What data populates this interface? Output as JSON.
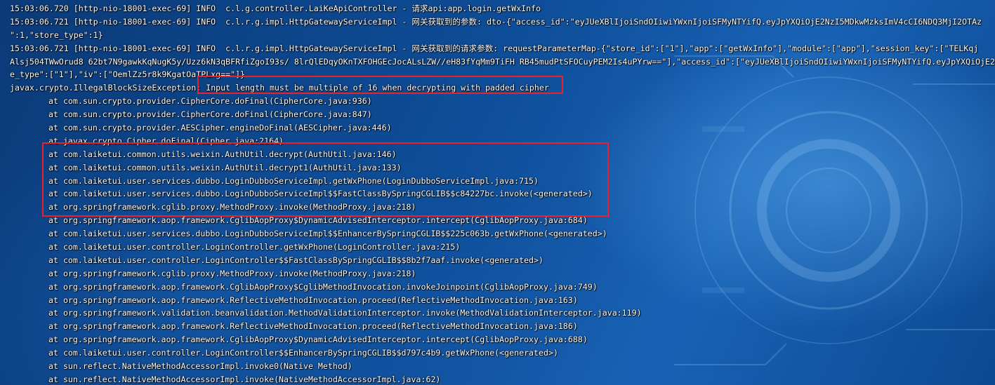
{
  "log": {
    "head_lines": [
      "15:03:06.720 [http-nio-18001-exec-69] INFO  c.l.g.controller.LaiKeApiController - 请求api:app.login.getWxInfo",
      "15:03:06.721 [http-nio-18001-exec-69] INFO  c.l.r.g.impl.HttpGatewayServiceImpl - 网关获取到的参数: dto-{\"access_id\":\"eyJUeXBlIjoiSndOIiwiYWxnIjoiSFMyNTYifQ.eyJpYXQiOjE2NzI5MDkwMzksImV4cCI6NDQ3MjI2OTAz",
      "\":1,\"store_type\":1}",
      "15:03:06.721 [http-nio-18001-exec-69] INFO  c.l.r.g.impl.HttpGatewayServiceImpl - 网关获取到的请求参数: requestParameterMap-{\"store_id\":[\"1\"],\"app\":[\"getWxInfo\"],\"module\":[\"app\"],\"session_key\":[\"TELKqj",
      "Alsj504TWwOrud8 62bt7N9gawkKqNugK5y/Uzz6kN3qBFRfiZgoI93s/ 8lrQlEDqyOKnTXFOHGEcJocALsLZW//eH83fYqMm9TiFH RB45mudPtSFOCuyPEM2Is4uPYrw==\"],\"access_id\":[\"eyJUeXBlIjoiSndOIiwiYWxnIjoiSFMyNTYifQ.eyJpYXQiOjE2",
      "e_type\":[\"1\"],\"iv\":[\"OemlZz5r8k9KgatOaTPLxg==\"]}"
    ],
    "exception_class": "javax.crypto.IllegalBlockSizeException:",
    "exception_message": " Input length must be multiple of 16 when decrypting with padded cipher",
    "stack_frames": [
      "at com.sun.crypto.provider.CipherCore.doFinal(CipherCore.java:936)",
      "at com.sun.crypto.provider.CipherCore.doFinal(CipherCore.java:847)",
      "at com.sun.crypto.provider.AESCipher.engineDoFinal(AESCipher.java:446)",
      "at javax.crypto.Cipher.doFinal(Cipher.java:2164)",
      "at com.laiketui.common.utils.weixin.AuthUtil.decrypt(AuthUtil.java:146)",
      "at com.laiketui.common.utils.weixin.AuthUtil.decrypt1(AuthUtil.java:133)",
      "at com.laiketui.user.services.dubbo.LoginDubboServiceImpl.getWxPhone(LoginDubboServiceImpl.java:715)",
      "at com.laiketui.user.services.dubbo.LoginDubboServiceImpl$$FastClassBySpringCGLIB$$c84227bc.invoke(<generated>)",
      "at org.springframework.cglib.proxy.MethodProxy.invoke(MethodProxy.java:218)",
      "at org.springframework.aop.framework.CglibAopProxy$DynamicAdvisedInterceptor.intercept(CglibAopProxy.java:684)",
      "at com.laiketui.user.services.dubbo.LoginDubboServiceImpl$$EnhancerBySpringCGLIB$$225c063b.getWxPhone(<generated>)",
      "at com.laiketui.user.controller.LoginController.getWxPhone(LoginController.java:215)",
      "at com.laiketui.user.controller.LoginController$$FastClassBySpringCGLIB$$8b2f7aaf.invoke(<generated>)",
      "at org.springframework.cglib.proxy.MethodProxy.invoke(MethodProxy.java:218)",
      "at org.springframework.aop.framework.CglibAopProxy$CglibMethodInvocation.invokeJoinpoint(CglibAopProxy.java:749)",
      "at org.springframework.aop.framework.ReflectiveMethodInvocation.proceed(ReflectiveMethodInvocation.java:163)",
      "at org.springframework.validation.beanvalidation.MethodValidationInterceptor.invoke(MethodValidationInterceptor.java:119)",
      "at org.springframework.aop.framework.ReflectiveMethodInvocation.proceed(ReflectiveMethodInvocation.java:186)",
      "at org.springframework.aop.framework.CglibAopProxy$DynamicAdvisedInterceptor.intercept(CglibAopProxy.java:688)",
      "at com.laiketui.user.controller.LoginController$$EnhancerBySpringCGLIB$$d797c4b9.getWxPhone(<generated>)",
      "at sun.reflect.NativeMethodAccessorImpl.invoke0(Native Method)",
      "at sun.reflect.NativeMethodAccessorImpl.invoke(NativeMethodAccessorImpl.java:62)"
    ]
  },
  "colors": {
    "text": "#ffffff",
    "highlight_border": "#e8212b",
    "background": "#0e4d98"
  }
}
